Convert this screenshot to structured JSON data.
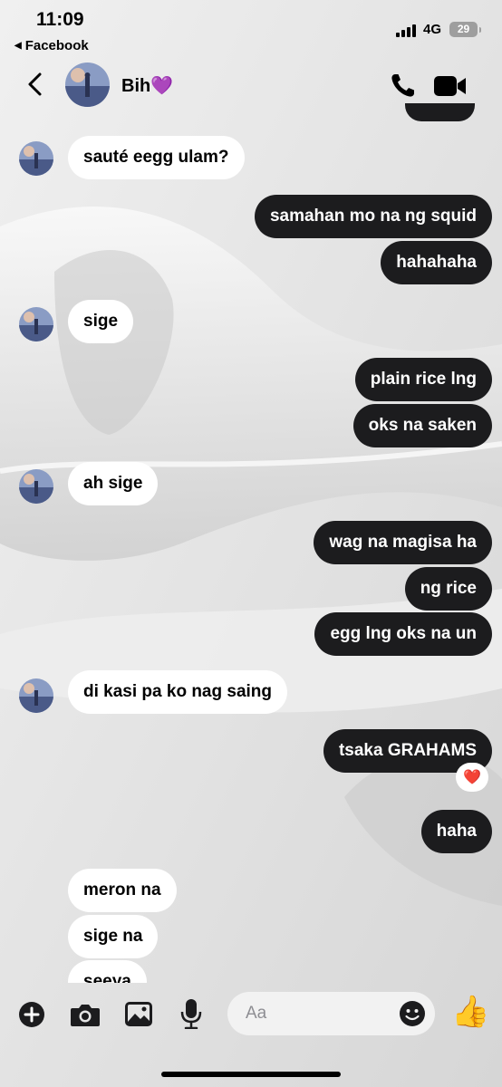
{
  "status_bar": {
    "time": "11:09",
    "back_app": "Facebook",
    "network": "4G",
    "battery": "29"
  },
  "header": {
    "contact_name": "Bih💜",
    "icons": [
      "back-chevron-icon",
      "phone-icon",
      "video-camera-icon"
    ]
  },
  "messages": [
    {
      "from": "them",
      "text": "sauté eegg ulam?"
    },
    {
      "from": "me",
      "text": "samahan mo na ng squid"
    },
    {
      "from": "me",
      "text": "hahahaha"
    },
    {
      "from": "them",
      "text": "sige"
    },
    {
      "from": "me",
      "text": "plain rice lng"
    },
    {
      "from": "me",
      "text": "oks na saken"
    },
    {
      "from": "them",
      "text": "ah sige"
    },
    {
      "from": "me",
      "text": "wag na magisa ha"
    },
    {
      "from": "me",
      "text": "ng rice"
    },
    {
      "from": "me",
      "text": "egg lng oks na un"
    },
    {
      "from": "them",
      "text": "di kasi pa ko nag saing"
    },
    {
      "from": "me",
      "text": "tsaka GRAHAMS",
      "reaction": "❤️"
    },
    {
      "from": "me",
      "text": "haha"
    },
    {
      "from": "them",
      "text": "meron na"
    },
    {
      "from": "them",
      "text": "sige na"
    },
    {
      "from": "them",
      "text": "seeya"
    }
  ],
  "composer": {
    "placeholder": "Aa",
    "value": "",
    "like_emoji": "👍",
    "icons": [
      "plus-icon",
      "camera-icon",
      "gallery-icon",
      "microphone-icon",
      "emoji-icon"
    ]
  },
  "colors": {
    "outgoing_bubble": "#1c1c1e",
    "incoming_bubble": "#ffffff",
    "background": "#e4e4e4"
  }
}
